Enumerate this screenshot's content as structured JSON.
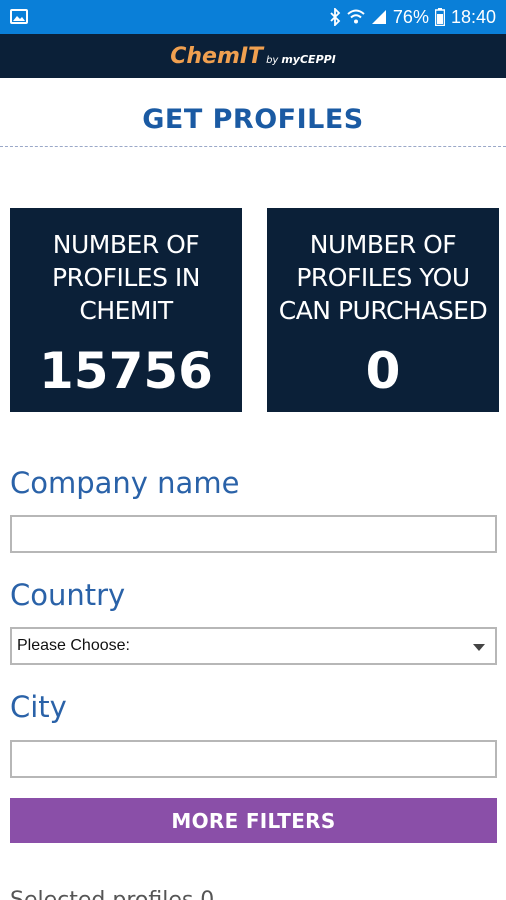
{
  "status_bar": {
    "battery": "76%",
    "time": "18:40",
    "icons": [
      "gallery-icon",
      "bluetooth-icon",
      "wifi-icon",
      "signal-icon",
      "battery-icon"
    ]
  },
  "header": {
    "logo_main": "ChemIT",
    "logo_by": "by",
    "logo_brand": "myCEPPI"
  },
  "page": {
    "title": "GET PROFILES"
  },
  "stats": [
    {
      "label": "NUMBER OF PROFILES IN CHEMIT",
      "value": "15756"
    },
    {
      "label": "NUMBER OF PROFILES YOU CAN PURCHASED",
      "value": "0"
    }
  ],
  "form": {
    "company_label": "Company name",
    "company_value": "",
    "country_label": "Country",
    "country_selected": "Please Choose:",
    "city_label": "City",
    "city_value": "",
    "more_filters": "MORE FILTERS"
  },
  "footer": {
    "partial_text": "Selected profiles 0"
  },
  "colors": {
    "status_bar": "#0a7fd8",
    "header_bg": "#0b2038",
    "logo_accent": "#f0a050",
    "title": "#1a5aa3",
    "label": "#2a62a8",
    "button": "#8a4fa8"
  }
}
